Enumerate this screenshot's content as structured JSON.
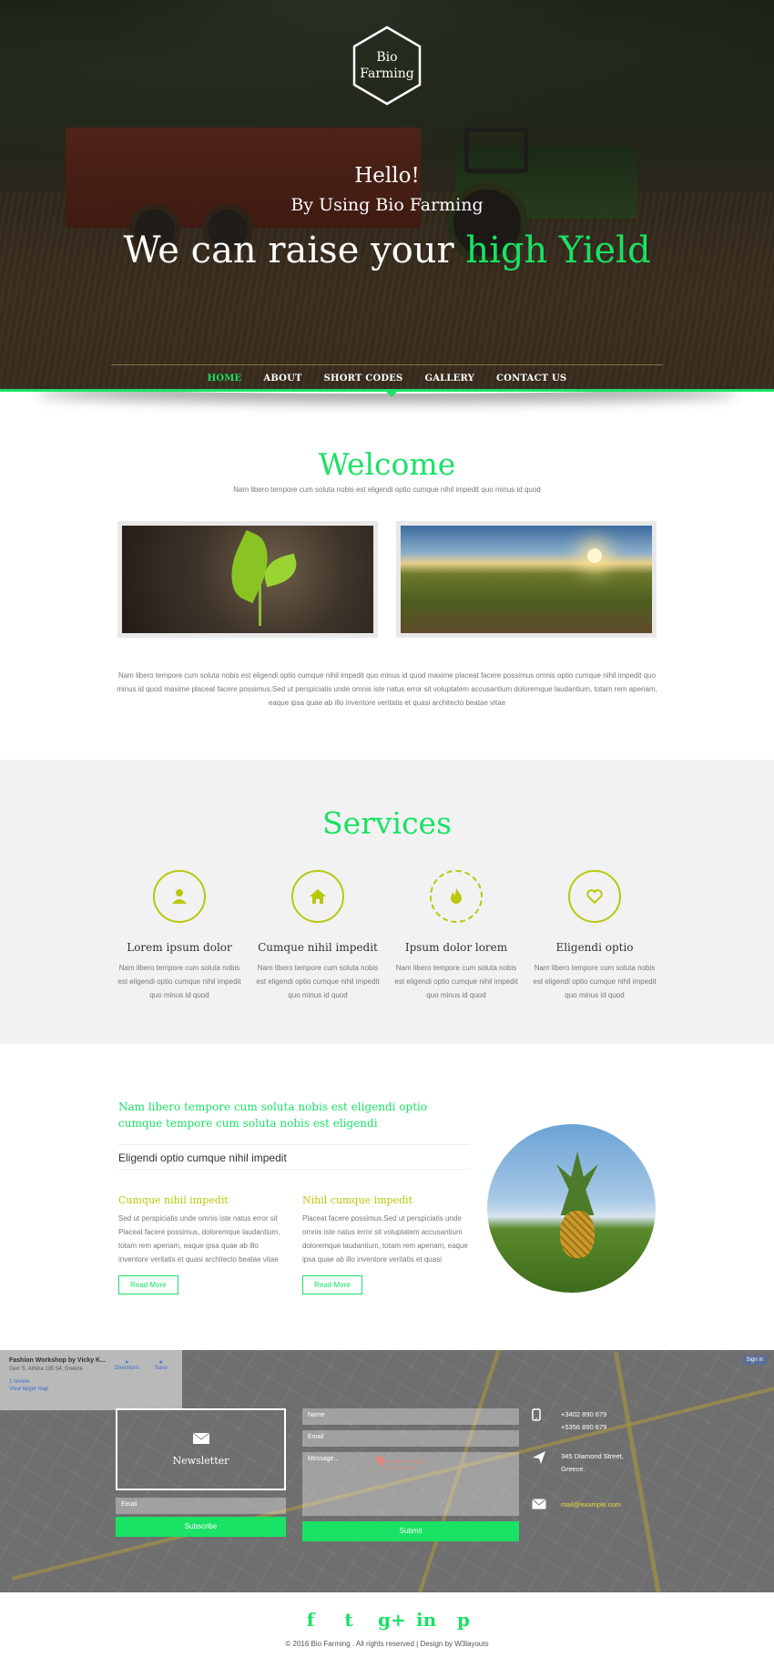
{
  "hero": {
    "logo_line1": "Bio",
    "logo_line2": "Farming",
    "greeting": "Hello!",
    "subtitle": "By Using Bio Farming",
    "headline_pre": "We can raise your ",
    "headline_highlight": "high Yield"
  },
  "nav": {
    "items": [
      {
        "label": "HOME",
        "active": true
      },
      {
        "label": "ABOUT"
      },
      {
        "label": "SHORT CODES"
      },
      {
        "label": "GALLERY"
      },
      {
        "label": "CONTACT US"
      }
    ]
  },
  "welcome": {
    "title": "Welcome",
    "subtitle": "Nam libero tempore cum soluta nobis est eligendi optio cumque nihil impedit quo minus id quod",
    "body": "Nam libero tempore cum soluta nobis est eligendi optio cumque nihil impedit quo minus id quod maxime placeat facere possimus omnis optio cumque nihil impedit quo minus id quod maxime placeat facere possimus.Sed ut perspiciatis unde omnis iste natus error sit voluptatem accusantium doloremque laudantium, totam rem aperiam, eaque ipsa quae ab illo inventore veritatis et quasi architecto beatae vitae"
  },
  "services": {
    "title": "Services",
    "items": [
      {
        "icon": "user-icon",
        "title": "Lorem ipsum dolor",
        "text": "Nam libero tempore cum soluta nobis est eligendi optio cumque nihil impedit quo minus id quod"
      },
      {
        "icon": "home-icon",
        "title": "Cumque nihil impedit",
        "text": "Nam libero tempore cum soluta nobis est eligendi optio cumque nihil impedit quo minus id quod"
      },
      {
        "icon": "fire-icon",
        "title": "Ipsum dolor lorem",
        "text": "Nam libero tempore cum soluta nobis est eligendi optio cumque nihil impedit quo minus id quod"
      },
      {
        "icon": "heart-icon",
        "title": "Eligendi optio",
        "text": "Nam libero tempore cum soluta nobis est eligendi optio cumque nihil impedit quo minus id quod"
      }
    ]
  },
  "info": {
    "lead": "Nam libero tempore cum soluta nobis est eligendi optio cumque tempore cum soluta nobis est eligendi",
    "mid": "Eligendi optio cumque nihil impedit",
    "col1_title": "Cumque nihil impedit",
    "col1_text": "Sed ut perspiciatis unde omnis iste natus error sit Placeat facere possimus, doloremque laudantium, totam rem aperiam, eaque ipsa quae ab illo inventore veritatis et quasi architecto beatae vitae",
    "col2_title": "Nihil cumque impedit",
    "col2_text": "Placeat facere possimus.Sed ut perspiciatis unde omnis iste natus error sit voluptatem accusantium doloremque laudantium, totam rem aperiam, eaque ipsa quae ab illo inventore veritatis et quasi",
    "read_more": "Read More"
  },
  "map": {
    "place_title": "Fashion Workshop by Vicky K...",
    "place_addr": "Gerr S. Athina 105 54, Greece",
    "reviews": "1 review",
    "larger_map": "View larger map",
    "directions": "Directions",
    "save": "Save",
    "sign_in": "Sign in",
    "pin_label_1": "Fashion Workshop",
    "pin_label_2": "by Vicky Kaya"
  },
  "contact": {
    "newsletter_label": "Newsletter",
    "email_placeholder": "Email",
    "subscribe": "Subscribe",
    "name_placeholder": "Name",
    "email2_placeholder": "Email",
    "message_placeholder": "Message...",
    "submit": "Submit",
    "phone1": "+3402 890 679",
    "phone2": "+5356 890 679",
    "address1": "345 Diamond Street,",
    "address2": "Greece.",
    "email": "mail@example.com"
  },
  "footer": {
    "social": [
      "f",
      "t",
      "g+",
      "in",
      "p"
    ],
    "copyright": "© 2016 Bio Farming . All rights reserved | Design by W3layouts"
  },
  "colors": {
    "accent": "#19e264",
    "olive": "#b9c80d"
  }
}
